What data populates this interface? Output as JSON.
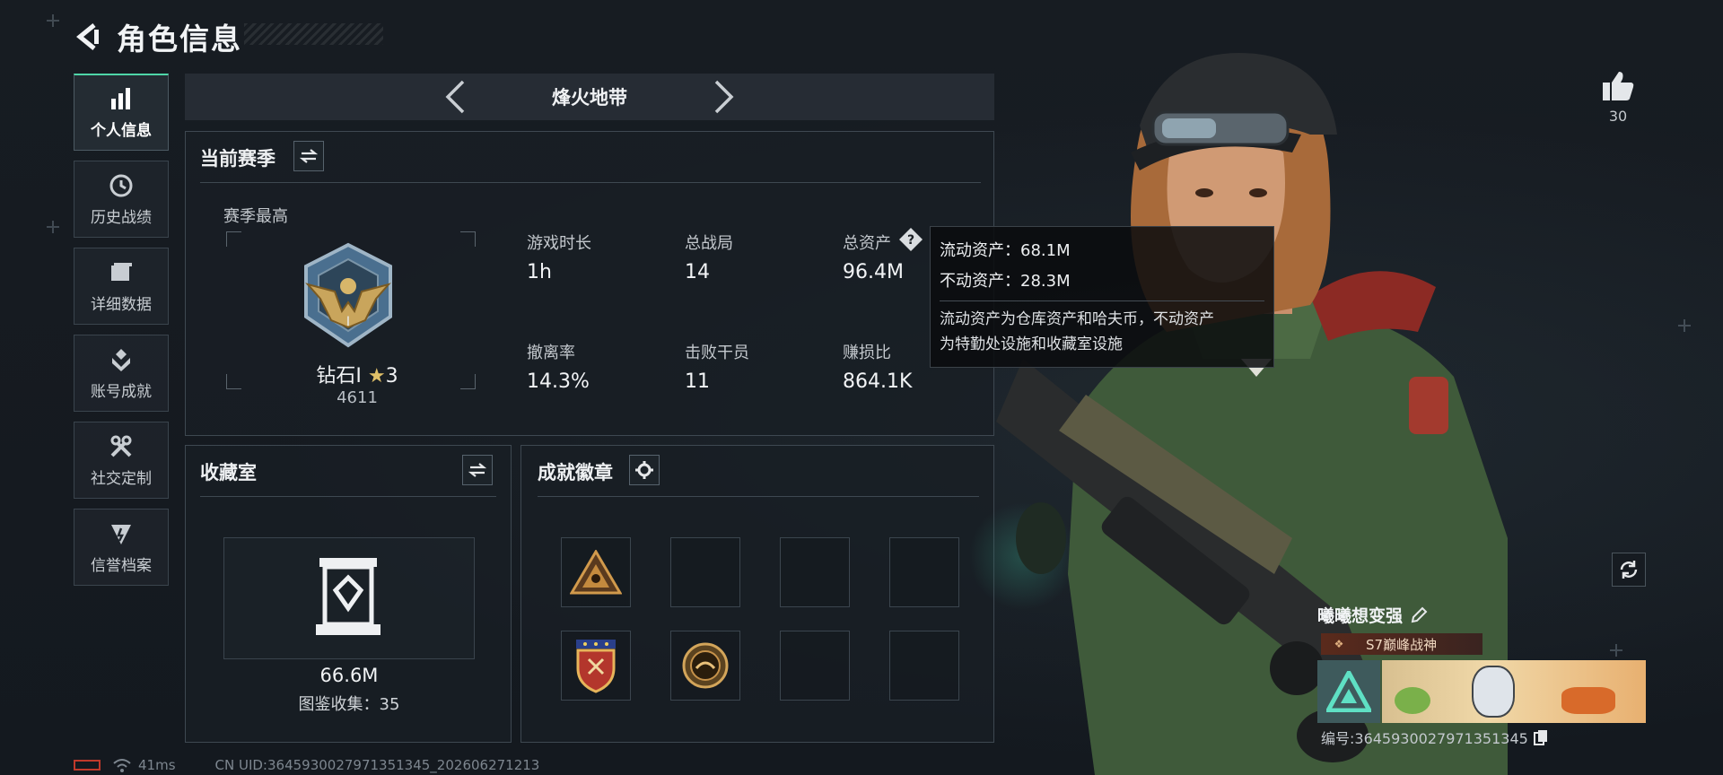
{
  "header": {
    "title": "角色信息"
  },
  "sidebar": {
    "items": [
      {
        "label": "个人信息",
        "icon": "bar-chart-icon",
        "active": true
      },
      {
        "label": "历史战绩",
        "icon": "history-clock-icon",
        "active": false
      },
      {
        "label": "详细数据",
        "icon": "folder-icon",
        "active": false
      },
      {
        "label": "账号成就",
        "icon": "achievement-icon",
        "active": false
      },
      {
        "label": "社交定制",
        "icon": "tools-icon",
        "active": false
      },
      {
        "label": "信誉档案",
        "icon": "credit-icon",
        "active": false
      }
    ]
  },
  "mode": {
    "name": "烽火地带"
  },
  "season": {
    "title": "当前赛季",
    "best_label": "赛季最高",
    "rank_name": "钻石Ⅰ",
    "rank_stars": "3",
    "rank_score": "4611",
    "stats": [
      {
        "label": "游戏时长",
        "value": "1h"
      },
      {
        "label": "总战局",
        "value": "14"
      },
      {
        "label": "总资产",
        "value": "96.4M"
      },
      {
        "label": "撤离率",
        "value": "14.3%"
      },
      {
        "label": "击败干员",
        "value": "11"
      },
      {
        "label": "赚损比",
        "value": "864.1K"
      }
    ]
  },
  "tooltip": {
    "line1": "流动资产：68.1M",
    "line2": "不动资产：28.3M",
    "desc1": "流动资产为仓库资产和哈夫币，不动资产",
    "desc2": "为特勤处设施和收藏室设施"
  },
  "collection": {
    "title": "收藏室",
    "value": "66.6M",
    "sub": "图鉴收集：35"
  },
  "badges": {
    "title": "成就徽章"
  },
  "likes": {
    "count": "30"
  },
  "player": {
    "name": "曦曦想变强",
    "title": "S7巅峰战神",
    "id": "编号:3645930027971351345"
  },
  "status": {
    "ping": "41ms",
    "uid": "CN UID:3645930027971351345_202606271213"
  },
  "colors": {
    "accent": "#4fd6a8",
    "bg": "#161b21",
    "panel_border": "#3e4851"
  }
}
